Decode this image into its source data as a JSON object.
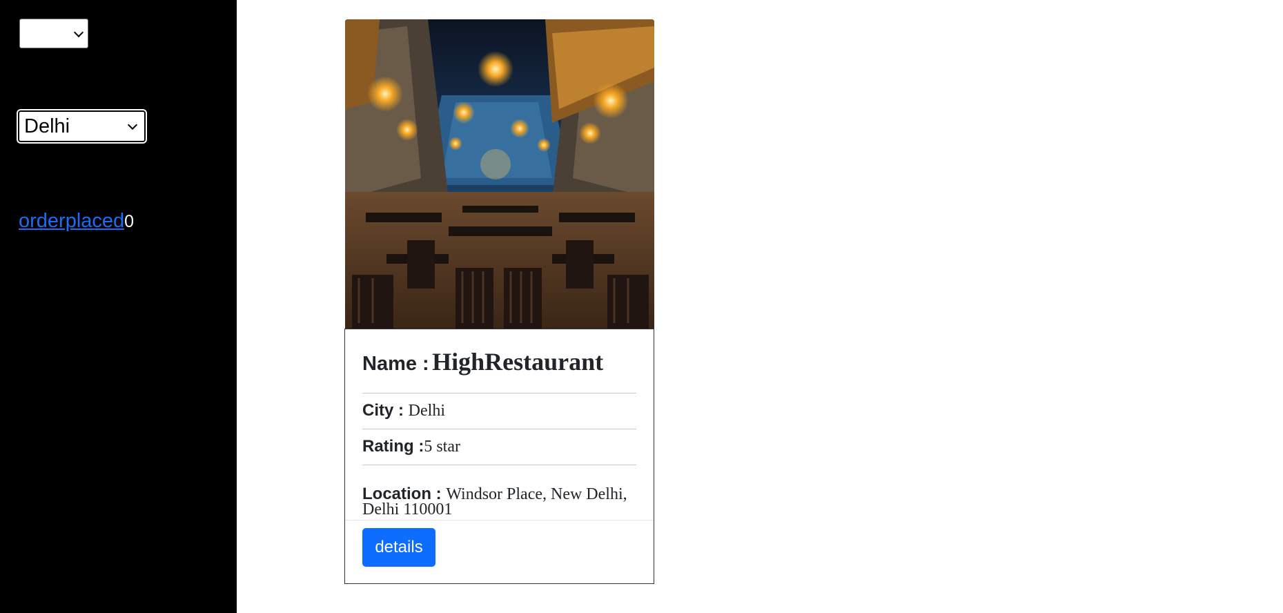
{
  "sidebar": {
    "top_select": {
      "selected": ""
    },
    "city_select": {
      "selected": "Delhi"
    },
    "order_link": {
      "label": "orderplaced",
      "count": "0"
    }
  },
  "card": {
    "image_icon": "restaurant-photo",
    "name_label": "Name :",
    "name": "HighRestaurant",
    "city_label": "City :",
    "city": "Delhi",
    "rating_label": "Rating :",
    "rating": "5 star",
    "location_label": "Location :",
    "location": "Windsor Place, New Delhi, Delhi 110001",
    "details_button": "details"
  },
  "colors": {
    "sidebar_bg": "#000000",
    "link": "#1a6ef5",
    "button": "#0d6efd"
  }
}
